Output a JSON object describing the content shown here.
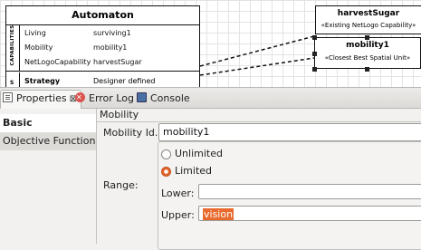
{
  "diagram": {
    "automaton": {
      "title": "Automaton",
      "capabilities_band": "CAPABILITIES",
      "strategy_band": "S",
      "capabilities": [
        {
          "name": "Living",
          "value": "surviving1"
        },
        {
          "name": "Mobility",
          "value": "mobility1"
        },
        {
          "name": "NetLogoCapability",
          "value": "harvestSugar"
        }
      ],
      "strategy": {
        "name": "Strategy",
        "value": "Designer defined"
      }
    },
    "harvest_box": {
      "title": "harvestSugar",
      "stereotype": "«Existing NetLogo Capability»"
    },
    "mobility_box": {
      "title": "mobility1",
      "stereotype": "«Closest Best Spatial Unit»"
    }
  },
  "tabs": [
    {
      "label": "Properties",
      "icon": "properties-icon",
      "active": true,
      "close": "⊠"
    },
    {
      "label": "Error Log",
      "icon": "error-log-icon",
      "active": false
    },
    {
      "label": "Console",
      "icon": "console-icon",
      "active": false
    }
  ],
  "properties": {
    "categories": [
      "Basic",
      "Objective Function"
    ],
    "section_title": "Mobility",
    "mobility_id_label": "Mobility Id.:",
    "mobility_id_value": "mobility1",
    "range_label": "Range:",
    "range_options": [
      "Unlimited",
      "Limited"
    ],
    "range_selected": "Limited",
    "lower_label": "Lower:",
    "lower_value": "",
    "upper_label": "Upper:",
    "upper_value": "vision"
  },
  "colors": {
    "accent": "#e96a2e",
    "canvas": "#ffffff",
    "panel": "#f2f1f0"
  }
}
